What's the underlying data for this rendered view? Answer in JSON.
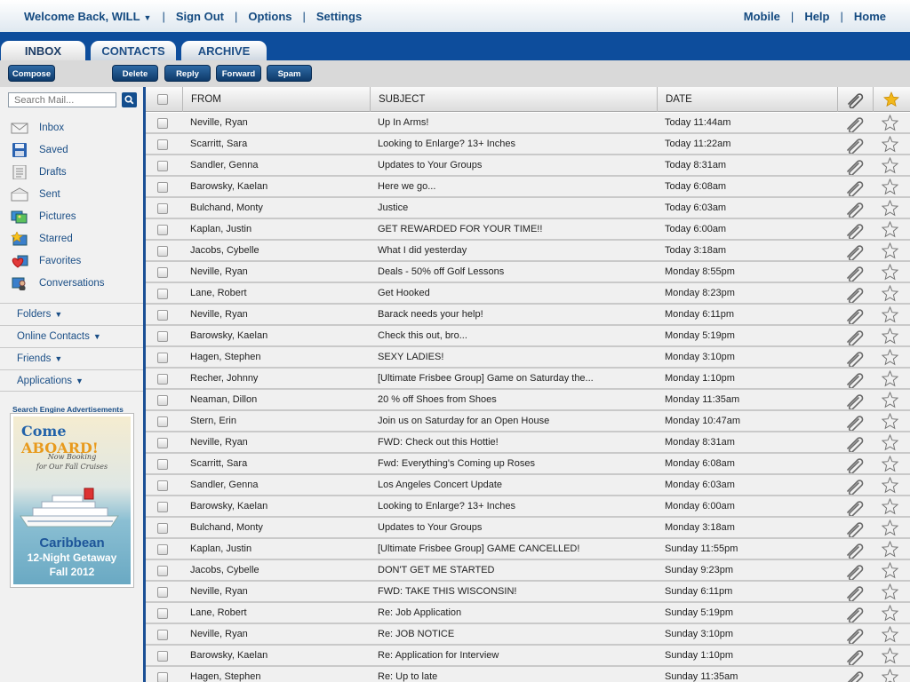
{
  "topbar": {
    "welcome": "Welcome Back, WILL",
    "sign_out": "Sign Out",
    "options": "Options",
    "settings": "Settings",
    "mobile": "Mobile",
    "help": "Help",
    "home": "Home"
  },
  "tabs": {
    "inbox": "INBOX",
    "contacts": "CONTACTS",
    "archive": "ARCHIVE"
  },
  "toolbar": {
    "compose": "Compose",
    "delete": "Delete",
    "reply": "Reply",
    "forward": "Forward",
    "spam": "Spam"
  },
  "search": {
    "placeholder": "Search Mail..."
  },
  "mailboxes": [
    {
      "label": "Inbox",
      "icon": "envelope-icon"
    },
    {
      "label": "Saved",
      "icon": "floppy-disk-icon"
    },
    {
      "label": "Drafts",
      "icon": "document-icon"
    },
    {
      "label": "Sent",
      "icon": "open-envelope-icon"
    },
    {
      "label": "Pictures",
      "icon": "pictures-icon"
    },
    {
      "label": "Starred",
      "icon": "starred-icon"
    },
    {
      "label": "Favorites",
      "icon": "heart-icon"
    },
    {
      "label": "Conversations",
      "icon": "conversations-icon"
    }
  ],
  "sections": [
    "Folders",
    "Online Contacts",
    "Friends",
    "Applications"
  ],
  "ad": {
    "title": "Search Engine Advertisements",
    "headline_a": "Come",
    "headline_b": "ABOARD!",
    "sub1": "Now Booking",
    "sub2": "for Our Fall Cruises",
    "line1": "Caribbean",
    "line2": "12-Night Getaway",
    "line3": "Fall 2012"
  },
  "columns": {
    "from": "FROM",
    "subject": "SUBJECT",
    "date": "DATE"
  },
  "emails": [
    {
      "from": "Neville, Ryan",
      "subject": "Up In Arms!",
      "date": "Today 11:44am"
    },
    {
      "from": "Scarritt, Sara",
      "subject": "Looking to Enlarge?  13+ Inches",
      "date": "Today 11:22am"
    },
    {
      "from": "Sandler, Genna",
      "subject": "Updates to Your Groups",
      "date": "Today 8:31am"
    },
    {
      "from": "Barowsky, Kaelan",
      "subject": "Here we go...",
      "date": "Today 6:08am"
    },
    {
      "from": "Bulchand, Monty",
      "subject": "Justice",
      "date": "Today 6:03am"
    },
    {
      "from": "Kaplan, Justin",
      "subject": "GET REWARDED FOR YOUR TIME!!",
      "date": "Today 6:00am"
    },
    {
      "from": "Jacobs, Cybelle",
      "subject": "What I did yesterday",
      "date": "Today 3:18am"
    },
    {
      "from": "Neville, Ryan",
      "subject": "Deals - 50% off Golf Lessons",
      "date": "Monday 8:55pm"
    },
    {
      "from": "Lane, Robert",
      "subject": "Get Hooked",
      "date": "Monday 8:23pm"
    },
    {
      "from": "Neville, Ryan",
      "subject": "Barack needs your help!",
      "date": "Monday 6:11pm"
    },
    {
      "from": "Barowsky, Kaelan",
      "subject": "Check this out, bro...",
      "date": "Monday 5:19pm"
    },
    {
      "from": "Hagen, Stephen",
      "subject": "SEXY LADIES!",
      "date": "Monday 3:10pm"
    },
    {
      "from": "Recher, Johnny",
      "subject": "[Ultimate Frisbee Group] Game on Saturday the...",
      "date": "Monday 1:10pm"
    },
    {
      "from": "Neaman, Dillon",
      "subject": "20 % off Shoes from Shoes",
      "date": "Monday 11:35am"
    },
    {
      "from": "Stern, Erin",
      "subject": "Join us on Saturday for an Open House",
      "date": "Monday 10:47am"
    },
    {
      "from": "Neville, Ryan",
      "subject": "FWD: Check out this Hottie!",
      "date": "Monday 8:31am"
    },
    {
      "from": "Scarritt, Sara",
      "subject": "Fwd:  Everything's Coming up Roses",
      "date": "Monday 6:08am"
    },
    {
      "from": "Sandler, Genna",
      "subject": "Los Angeles Concert Update",
      "date": "Monday 6:03am"
    },
    {
      "from": "Barowsky, Kaelan",
      "subject": "Looking to Enlarge?  13+ Inches",
      "date": "Monday 6:00am"
    },
    {
      "from": "Bulchand, Monty",
      "subject": "Updates to Your Groups",
      "date": "Monday 3:18am"
    },
    {
      "from": "Kaplan, Justin",
      "subject": "[Ultimate Frisbee Group] GAME CANCELLED!",
      "date": "Sunday 11:55pm"
    },
    {
      "from": "Jacobs, Cybelle",
      "subject": "DON'T GET ME STARTED",
      "date": "Sunday 9:23pm"
    },
    {
      "from": "Neville, Ryan",
      "subject": "FWD:  TAKE THIS WISCONSIN!",
      "date": "Sunday 6:11pm"
    },
    {
      "from": "Lane, Robert",
      "subject": "Re: Job Application",
      "date": "Sunday 5:19pm"
    },
    {
      "from": "Neville, Ryan",
      "subject": "Re: JOB NOTICE",
      "date": "Sunday 3:10pm"
    },
    {
      "from": "Barowsky, Kaelan",
      "subject": "Re: Application for Interview",
      "date": "Sunday 1:10pm"
    },
    {
      "from": "Hagen, Stephen",
      "subject": "Re: Up to late",
      "date": "Sunday 11:35am"
    }
  ],
  "colors": {
    "brand_blue": "#0d4d9c",
    "link_blue": "#144a80",
    "star_gold": "#f2b81b"
  }
}
